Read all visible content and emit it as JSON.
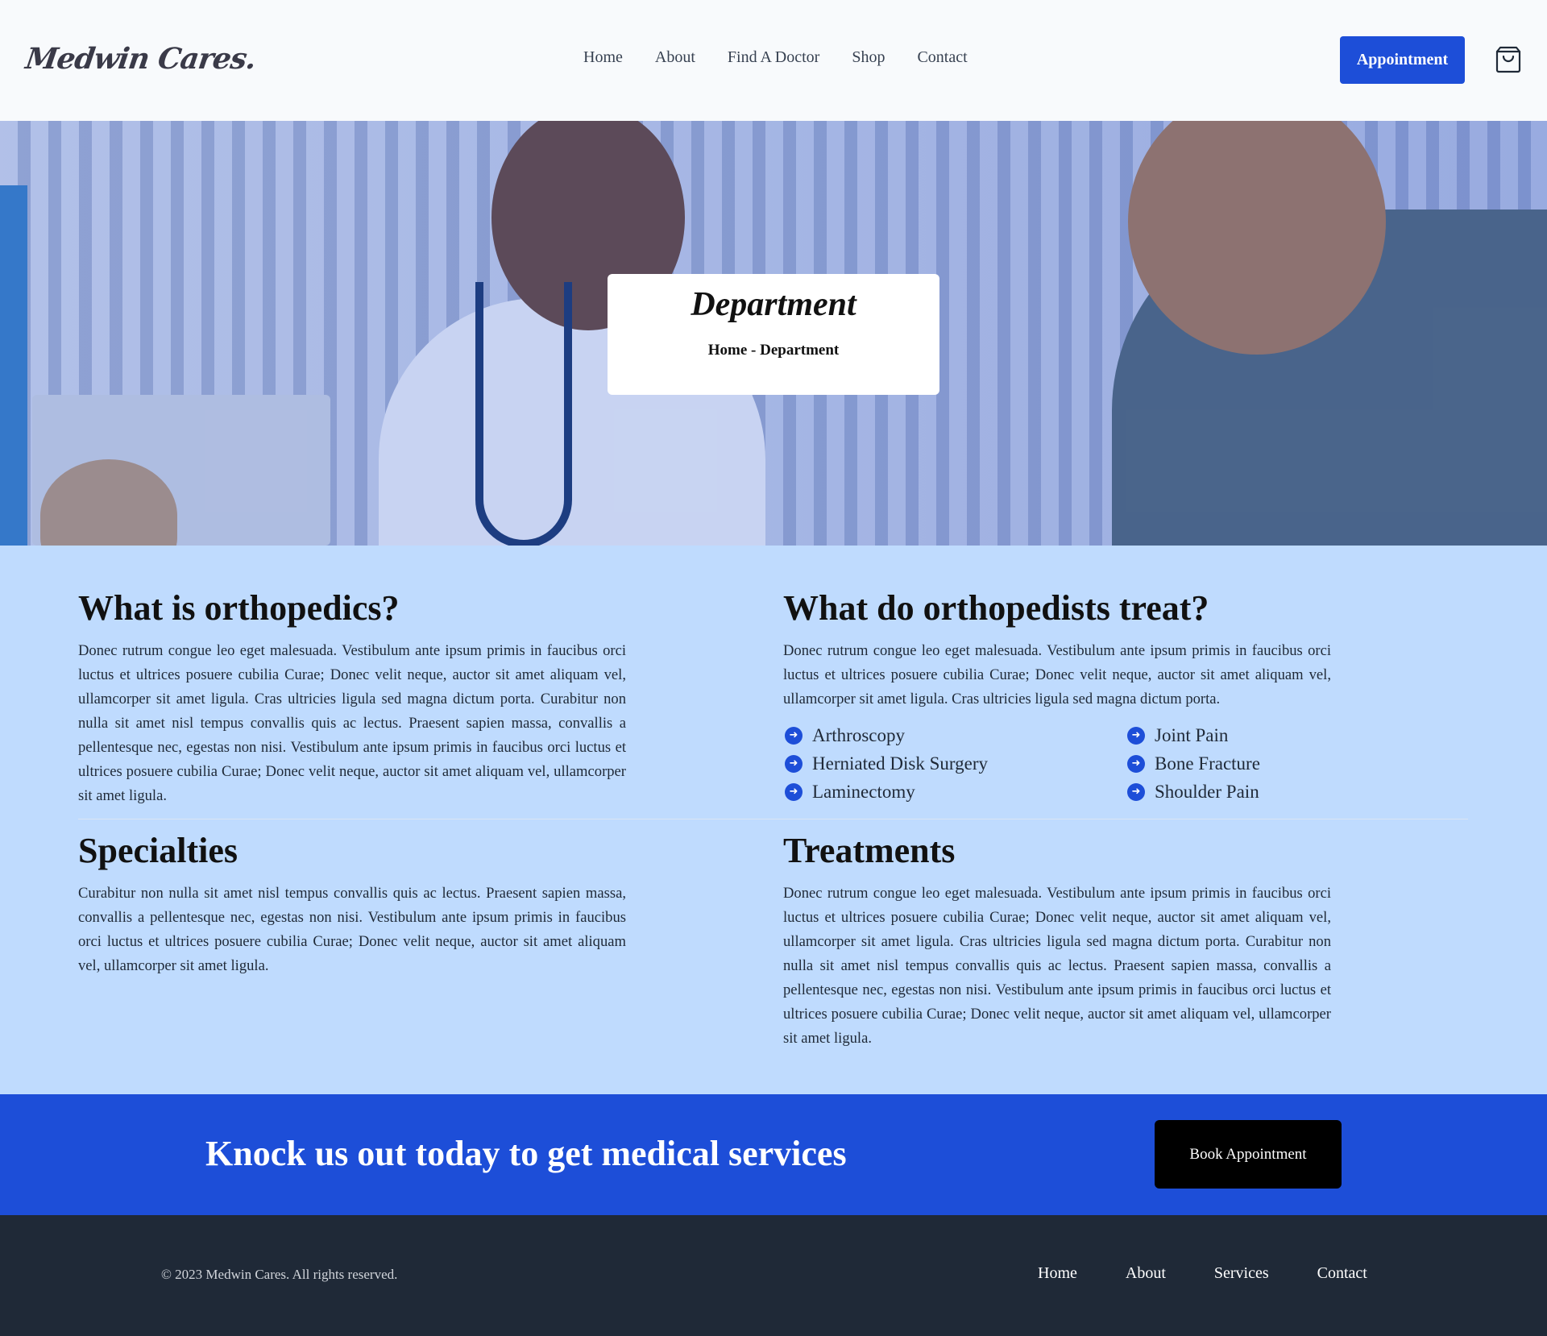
{
  "header": {
    "logo": "Medwin Cares.",
    "nav": [
      "Home",
      "About",
      "Find A Doctor",
      "Shop",
      "Contact"
    ],
    "appointment_label": "Appointment",
    "cart_icon": "shopping-bag-icon"
  },
  "hero": {
    "title": "Department",
    "breadcrumb": "Home - Department"
  },
  "sections": {
    "orthopedics": {
      "title": "What is orthopedics?",
      "text": "Donec rutrum congue leo eget malesuada. Vestibulum ante ipsum primis in faucibus orci luctus et ultrices posuere cubilia Curae; Donec velit neque, auctor sit amet aliquam vel, ullamcorper sit amet ligula. Cras ultricies ligula sed magna dictum porta. Curabitur non nulla sit amet nisl tempus convallis quis ac lectus. Praesent sapien massa, convallis a pellentesque nec, egestas non nisi. Vestibulum ante ipsum primis in faucibus orci luctus et ultrices posuere cubilia Curae; Donec velit neque, auctor sit amet aliquam vel, ullamcorper sit amet ligula."
    },
    "treat": {
      "title": "What do orthopedists treat?",
      "text": "Donec rutrum congue leo eget malesuada. Vestibulum ante ipsum primis in faucibus orci luctus et ultrices posuere cubilia Curae; Donec velit neque, auctor sit amet aliquam vel, ullamcorper sit amet ligula. Cras ultricies ligula sed magna dictum porta.",
      "items": [
        "Arthroscopy",
        "Joint Pain",
        "Herniated Disk Surgery",
        "Bone Fracture",
        "Laminectomy",
        "Shoulder Pain"
      ]
    },
    "specialties": {
      "title": "Specialties",
      "text": "Curabitur non nulla sit amet nisl tempus convallis quis ac lectus. Praesent sapien massa, convallis a pellentesque nec, egestas non nisi. Vestibulum ante ipsum primis in faucibus orci luctus et ultrices posuere cubilia Curae; Donec velit neque, auctor sit amet aliquam vel, ullamcorper sit amet ligula."
    },
    "treatments": {
      "title": "Treatments",
      "text": "Donec rutrum congue leo eget malesuada. Vestibulum ante ipsum primis in faucibus orci luctus et ultrices posuere cubilia Curae; Donec velit neque, auctor sit amet aliquam vel, ullamcorper sit amet ligula. Cras ultricies ligula sed magna dictum porta. Curabitur non nulla sit amet nisl tempus convallis quis ac lectus. Praesent sapien massa, convallis a pellentesque nec, egestas non nisi. Vestibulum ante ipsum primis in faucibus orci luctus et ultrices posuere cubilia Curae; Donec velit neque, auctor sit amet aliquam vel, ullamcorper sit amet ligula."
    }
  },
  "cta": {
    "heading": "Knock us out today to get medical services",
    "button": "Book Appointment"
  },
  "footer": {
    "copyright": "© 2023 Medwin Cares. All rights reserved.",
    "nav": [
      "Home",
      "About",
      "Services",
      "Contact"
    ]
  },
  "colors": {
    "accent": "#1d4ed8",
    "content_bg": "#bfdbfe",
    "footer_bg": "#1f2937"
  }
}
